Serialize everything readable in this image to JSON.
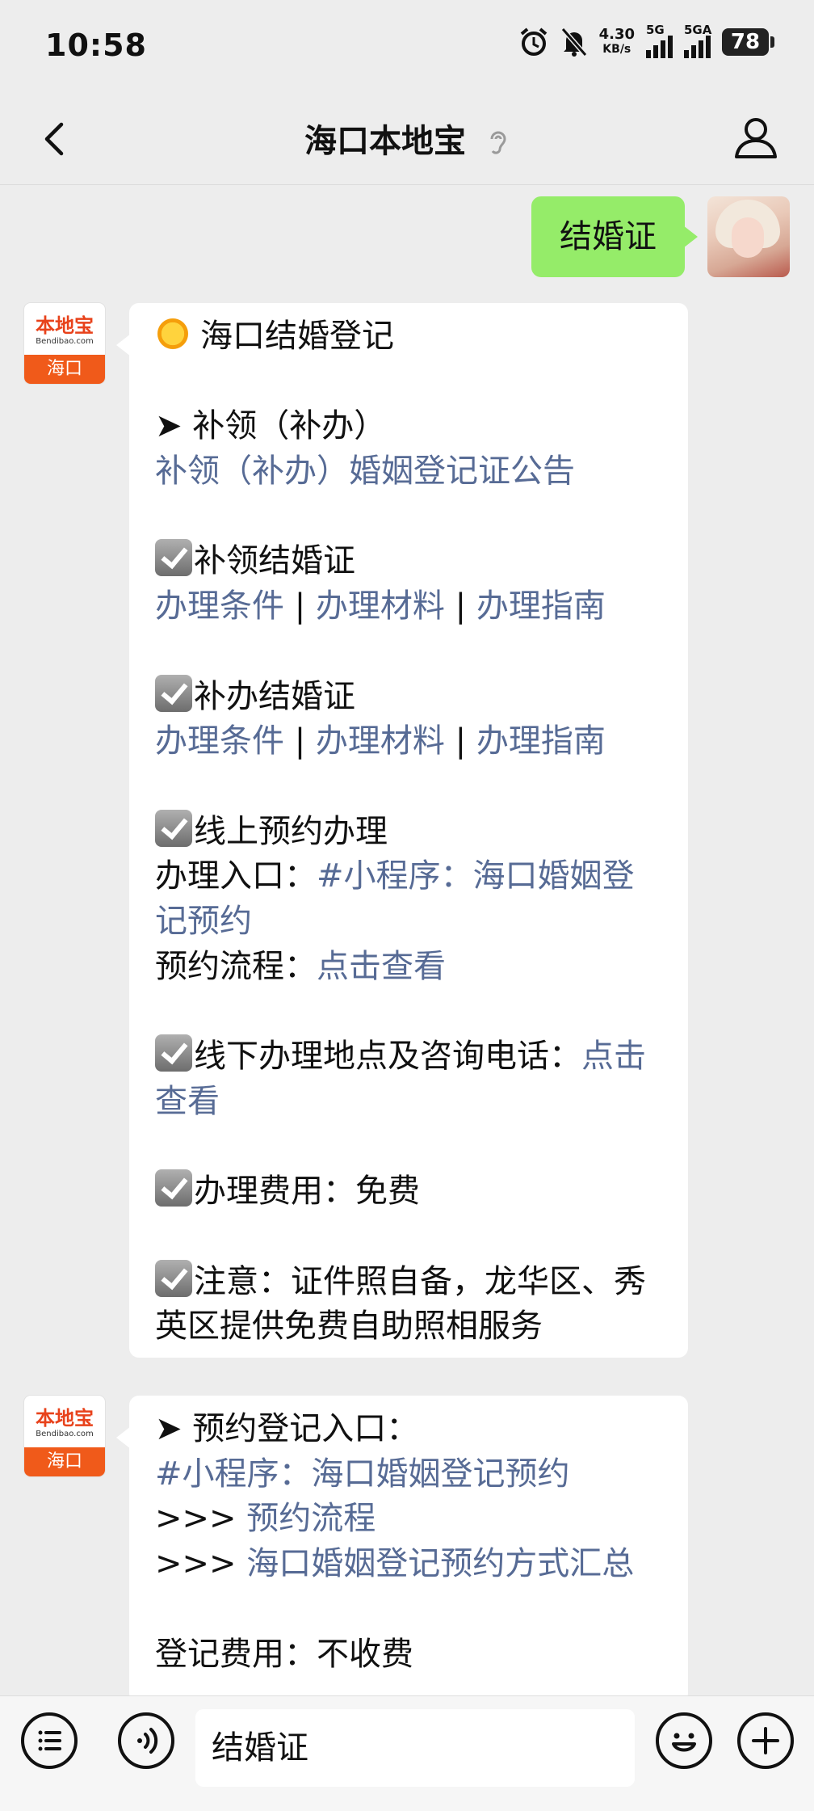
{
  "status": {
    "time": "10:58",
    "speed_value": "4.30",
    "speed_unit": "KB/s",
    "net1": "5G",
    "net2": "5GA",
    "battery": "78"
  },
  "header": {
    "title": "海口本地宝"
  },
  "my_message": "结婚证",
  "bot_avatar": {
    "logo": "本地宝",
    "site": "Bendibao.com",
    "city": "海口"
  },
  "msg1": {
    "heading": "海口结婚登记",
    "s1": {
      "title": "➤ 补领（补办）",
      "link": "补领（补办）婚姻登记证公告"
    },
    "s2": {
      "title": "补领结婚证",
      "l1": "办理条件",
      "sep": "|",
      "l2": "办理材料",
      "l3": "办理指南"
    },
    "s3": {
      "title": "补办结婚证",
      "l1": "办理条件",
      "l2": "办理材料",
      "l3": "办理指南"
    },
    "s4": {
      "title": "线上预约办理",
      "entry_label": "办理入口：",
      "entry_link": "#小程序：海口婚姻登记预约",
      "flow_label": "预约流程：",
      "flow_link": "点击查看"
    },
    "s5": {
      "text": "线下办理地点及咨询电话：",
      "link": "点击查看"
    },
    "s6": {
      "text": "办理费用：免费"
    },
    "s7": {
      "text": "注意：证件照自备，龙华区、秀英区提供免费自助照相服务"
    }
  },
  "msg2": {
    "title": "➤ 预约登记入口：",
    "link1": "#小程序：海口婚姻登记预约",
    "arrow": ">>>",
    "link2": "预约流程",
    "link3": "海口婚姻登记预约方式汇总",
    "fee": "登记费用：不收费"
  },
  "input": {
    "value": "结婚证"
  }
}
